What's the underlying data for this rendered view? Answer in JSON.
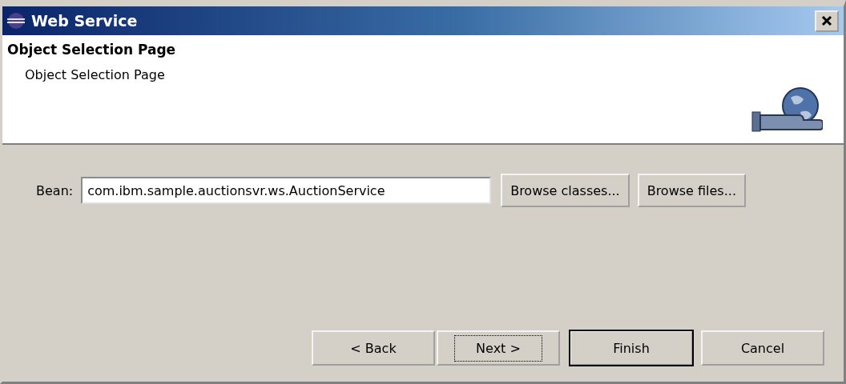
{
  "window": {
    "title": "Web Service"
  },
  "header": {
    "title": "Object Selection Page",
    "description": "Object Selection Page"
  },
  "bean": {
    "label": "Bean:",
    "value": "com.ibm.sample.auctionsvr.ws.AuctionService",
    "buttons": [
      "Browse classes...",
      "Browse files..."
    ]
  },
  "buttons": [
    {
      "label": "< Back",
      "default": false,
      "focused": false
    },
    {
      "label": "Next >",
      "default": false,
      "focused": true
    },
    {
      "label": "Finish",
      "default": true,
      "focused": false
    },
    {
      "label": "Cancel",
      "default": false,
      "focused": false
    }
  ]
}
